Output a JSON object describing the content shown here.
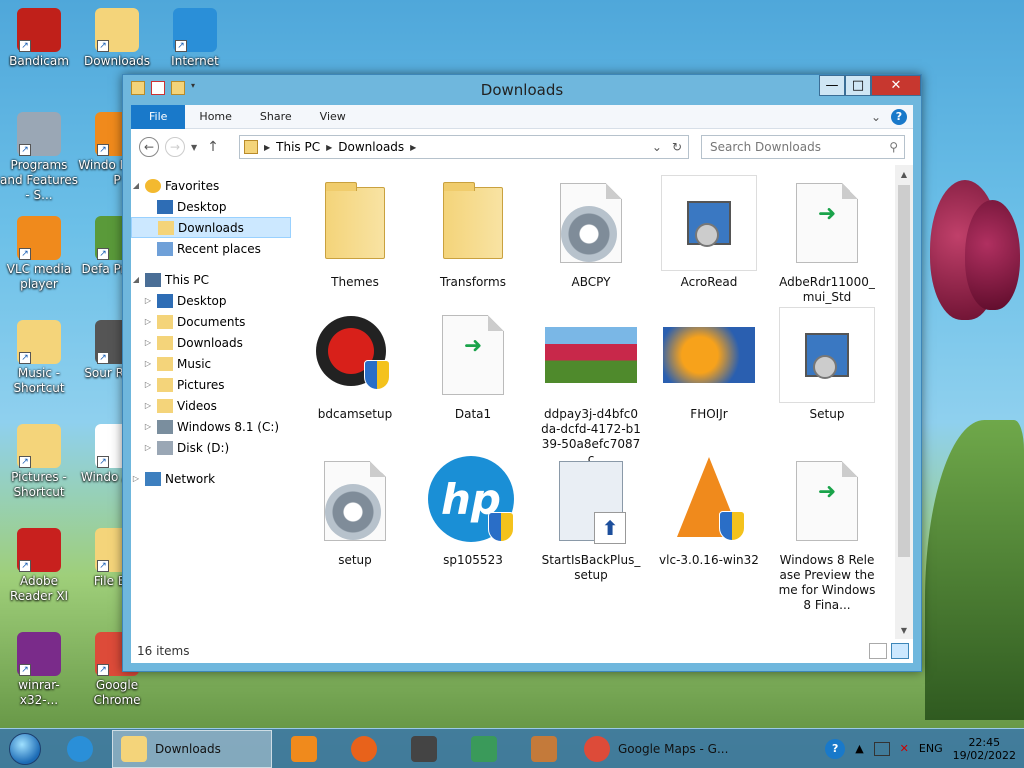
{
  "desktop": {
    "icons": [
      {
        "label": "Bandicam",
        "icon": "bandicam-icon",
        "color": "#c0201a"
      },
      {
        "label": "Downloads",
        "icon": "folder-download-icon",
        "color": "#f4d47a"
      },
      {
        "label": "Internet",
        "icon": "internet-explorer-icon",
        "color": "#2a8fd8"
      },
      {
        "label": "Programs and Features - S...",
        "icon": "programs-features-icon",
        "color": "#9aa7b5"
      },
      {
        "label": "Windo Media P",
        "icon": "media-player-icon",
        "color": "#f08a1c"
      },
      {
        "label": "VLC media player",
        "icon": "vlc-icon",
        "color": "#f08a1c"
      },
      {
        "label": "Defa Progra",
        "icon": "default-programs-icon",
        "color": "#5a9a3a"
      },
      {
        "label": "Music - Shortcut",
        "icon": "music-folder-icon",
        "color": "#f4d47a"
      },
      {
        "label": "Sour Recor",
        "icon": "sound-recorder-icon",
        "color": "#555555"
      },
      {
        "label": "Pictures - Shortcut",
        "icon": "pictures-folder-icon",
        "color": "#f4d47a"
      },
      {
        "label": "Windo Anyti",
        "icon": "windows-anytime-icon",
        "color": "#ffffff"
      },
      {
        "label": "Adobe Reader XI",
        "icon": "adobe-reader-icon",
        "color": "#c8201e"
      },
      {
        "label": "File Exp",
        "icon": "file-explorer-icon",
        "color": "#f4d47a"
      },
      {
        "label": "winrar-x32-...",
        "icon": "winrar-icon",
        "color": "#7a2b8a"
      },
      {
        "label": "Google Chrome",
        "icon": "chrome-icon",
        "color": "#dd4b39"
      }
    ]
  },
  "window": {
    "title": "Downloads",
    "buttons": {
      "minimize": "—",
      "maximize": "□",
      "close": "✕"
    },
    "ribbon_tabs": [
      "File",
      "Home",
      "Share",
      "View"
    ],
    "address": {
      "parts": [
        "This PC",
        "Downloads"
      ]
    },
    "search": {
      "placeholder": "Search Downloads"
    },
    "nav_tree": [
      {
        "label": "Favorites",
        "icon": "star-icon",
        "level": 0,
        "expander": "◢"
      },
      {
        "label": "Desktop",
        "icon": "desktop-icon",
        "level": 1
      },
      {
        "label": "Downloads",
        "icon": "downloads-folder-icon",
        "level": 1,
        "selected": true
      },
      {
        "label": "Recent places",
        "icon": "recent-places-icon",
        "level": 1
      },
      {
        "label": "This PC",
        "icon": "computer-icon",
        "level": 0,
        "expander": "◢",
        "gap": true
      },
      {
        "label": "Desktop",
        "icon": "desktop-icon",
        "level": 1,
        "expander": "▷"
      },
      {
        "label": "Documents",
        "icon": "documents-icon",
        "level": 1,
        "expander": "▷"
      },
      {
        "label": "Downloads",
        "icon": "downloads-folder-icon",
        "level": 1,
        "expander": "▷"
      },
      {
        "label": "Music",
        "icon": "music-icon",
        "level": 1,
        "expander": "▷"
      },
      {
        "label": "Pictures",
        "icon": "pictures-icon",
        "level": 1,
        "expander": "▷"
      },
      {
        "label": "Videos",
        "icon": "videos-icon",
        "level": 1,
        "expander": "▷"
      },
      {
        "label": "Windows 8.1 (C:)",
        "icon": "drive-c-icon",
        "level": 1,
        "expander": "▷"
      },
      {
        "label": "Disk (D:)",
        "icon": "drive-d-icon",
        "level": 1,
        "expander": "▷"
      },
      {
        "label": "Network",
        "icon": "network-icon",
        "level": 0,
        "expander": "▷",
        "gap": true
      }
    ],
    "files": [
      {
        "name": "Themes",
        "type": "folder"
      },
      {
        "name": "Transforms",
        "type": "folder"
      },
      {
        "name": "ABCPY",
        "type": "gear"
      },
      {
        "name": "AcroRead",
        "type": "installer",
        "boxed": true
      },
      {
        "name": "AdbeRdr11000_mui_Std",
        "type": "doc-arrow"
      },
      {
        "name": "bdcamsetup",
        "type": "bandicam"
      },
      {
        "name": "Data1",
        "type": "doc-arrow"
      },
      {
        "name": "ddpay3j-d4bfc0da-dcfd-4172-b139-50a8efc7087c",
        "type": "photo-tulips"
      },
      {
        "name": "FHOIJr",
        "type": "photo-leaves"
      },
      {
        "name": "Setup",
        "type": "installer",
        "boxed": true
      },
      {
        "name": "setup",
        "type": "gear"
      },
      {
        "name": "sp105523",
        "type": "hp"
      },
      {
        "name": "StartIsBackPlus_setup",
        "type": "startisback"
      },
      {
        "name": "vlc-3.0.16-win32",
        "type": "vlc"
      },
      {
        "name": "Windows 8 Release Preview theme for Windows 8 Fina...",
        "type": "doc-arrow"
      },
      {
        "name": "",
        "type": "winrar-partial"
      }
    ],
    "status": "16 items"
  },
  "taskbar": {
    "apps": [
      {
        "label": "",
        "icon": "internet-explorer-icon",
        "color": "#2a8fd8"
      },
      {
        "label": "Downloads",
        "icon": "file-explorer-icon",
        "color": "#f4d47a",
        "active": true
      },
      {
        "label": "",
        "icon": "vlc-icon",
        "color": "#f08a1c"
      },
      {
        "label": "",
        "icon": "firefox-icon",
        "color": "#e8621b"
      },
      {
        "label": "",
        "icon": "microphone-icon",
        "color": "#444444"
      },
      {
        "label": "",
        "icon": "monitor-arrow-icon",
        "color": "#3a9a5a"
      },
      {
        "label": "",
        "icon": "paint-icon",
        "color": "#c47a3a"
      },
      {
        "label": "Google Maps - G...",
        "icon": "chrome-icon",
        "color": "#dd4b39"
      }
    ],
    "tray": {
      "language": "ENG",
      "time": "22:45",
      "date": "19/02/2022"
    }
  }
}
